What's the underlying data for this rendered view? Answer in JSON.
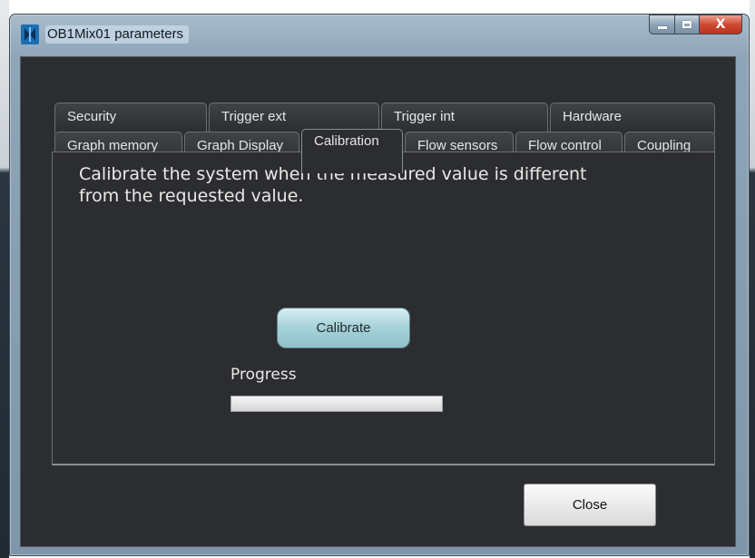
{
  "window": {
    "title": "OB1Mix01 parameters",
    "controls": {
      "close_glyph": "X"
    }
  },
  "tabs": {
    "back_row": [
      {
        "label": "Security"
      },
      {
        "label": "Trigger ext"
      },
      {
        "label": "Trigger int"
      },
      {
        "label": "Hardware"
      }
    ],
    "front_row": [
      {
        "label": "Graph memory"
      },
      {
        "label": "Graph Display"
      },
      {
        "label": "Calibration"
      },
      {
        "label": "Flow sensors"
      },
      {
        "label": "Flow control"
      },
      {
        "label": "Coupling"
      }
    ],
    "active": "Calibration"
  },
  "calibration": {
    "description": "Calibrate the system when the measured value is different from the requested value.",
    "button_label": "Calibrate",
    "progress_label": "Progress",
    "progress_fraction": 0
  },
  "footer": {
    "close_label": "Close"
  },
  "colors": {
    "client_bg": "#2c2d30",
    "accent_button": "#a8d3da",
    "title_close": "#cf4a32"
  },
  "icons": {
    "app": "ob1-app-icon",
    "minimize": "minimize-icon",
    "maximize": "maximize-icon",
    "close": "close-icon"
  }
}
